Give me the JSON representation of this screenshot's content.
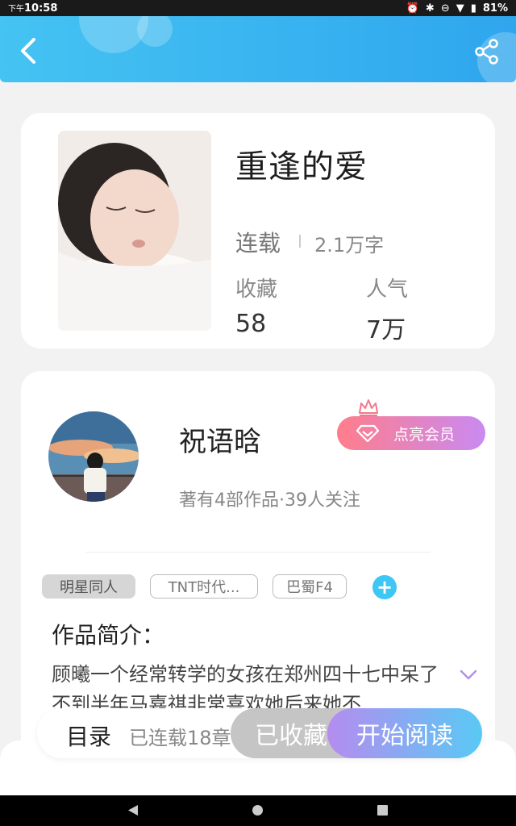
{
  "status_bar": {
    "time_prefix": "下午",
    "time": "10:58",
    "battery": "81%"
  },
  "header": {
    "back_icon": "chevron-left-icon",
    "share_icon": "share-icon",
    "bg_color": "#3bb6f0"
  },
  "book": {
    "title": "重逢的爱",
    "status": "连载",
    "word_count": "2.1万字",
    "favorites_label": "收藏",
    "favorites_value": "58",
    "popularity_label": "人气",
    "popularity_value": "7万"
  },
  "author": {
    "name": "祝语晗",
    "meta": "著有4部作品·39人关注",
    "vip_label": "点亮会员"
  },
  "tags": {
    "items": [
      "明星同人",
      "TNT时代...",
      "巴蜀F4"
    ],
    "add_icon": "plus-icon"
  },
  "intro": {
    "heading": "作品简介：",
    "text": "顾曦一个经常转学的女孩在郑州四十七中呆了不到半年马嘉祺非常喜欢她后来她不..."
  },
  "bottom_bar": {
    "toc_label": "目录",
    "chapters_label": "已连载18章",
    "collect_label": "已收藏",
    "read_label": "开始阅读"
  },
  "colors": {
    "accent": "#3ec6f5",
    "vip_start": "#ff7d8b",
    "vip_end": "#c98af2"
  }
}
